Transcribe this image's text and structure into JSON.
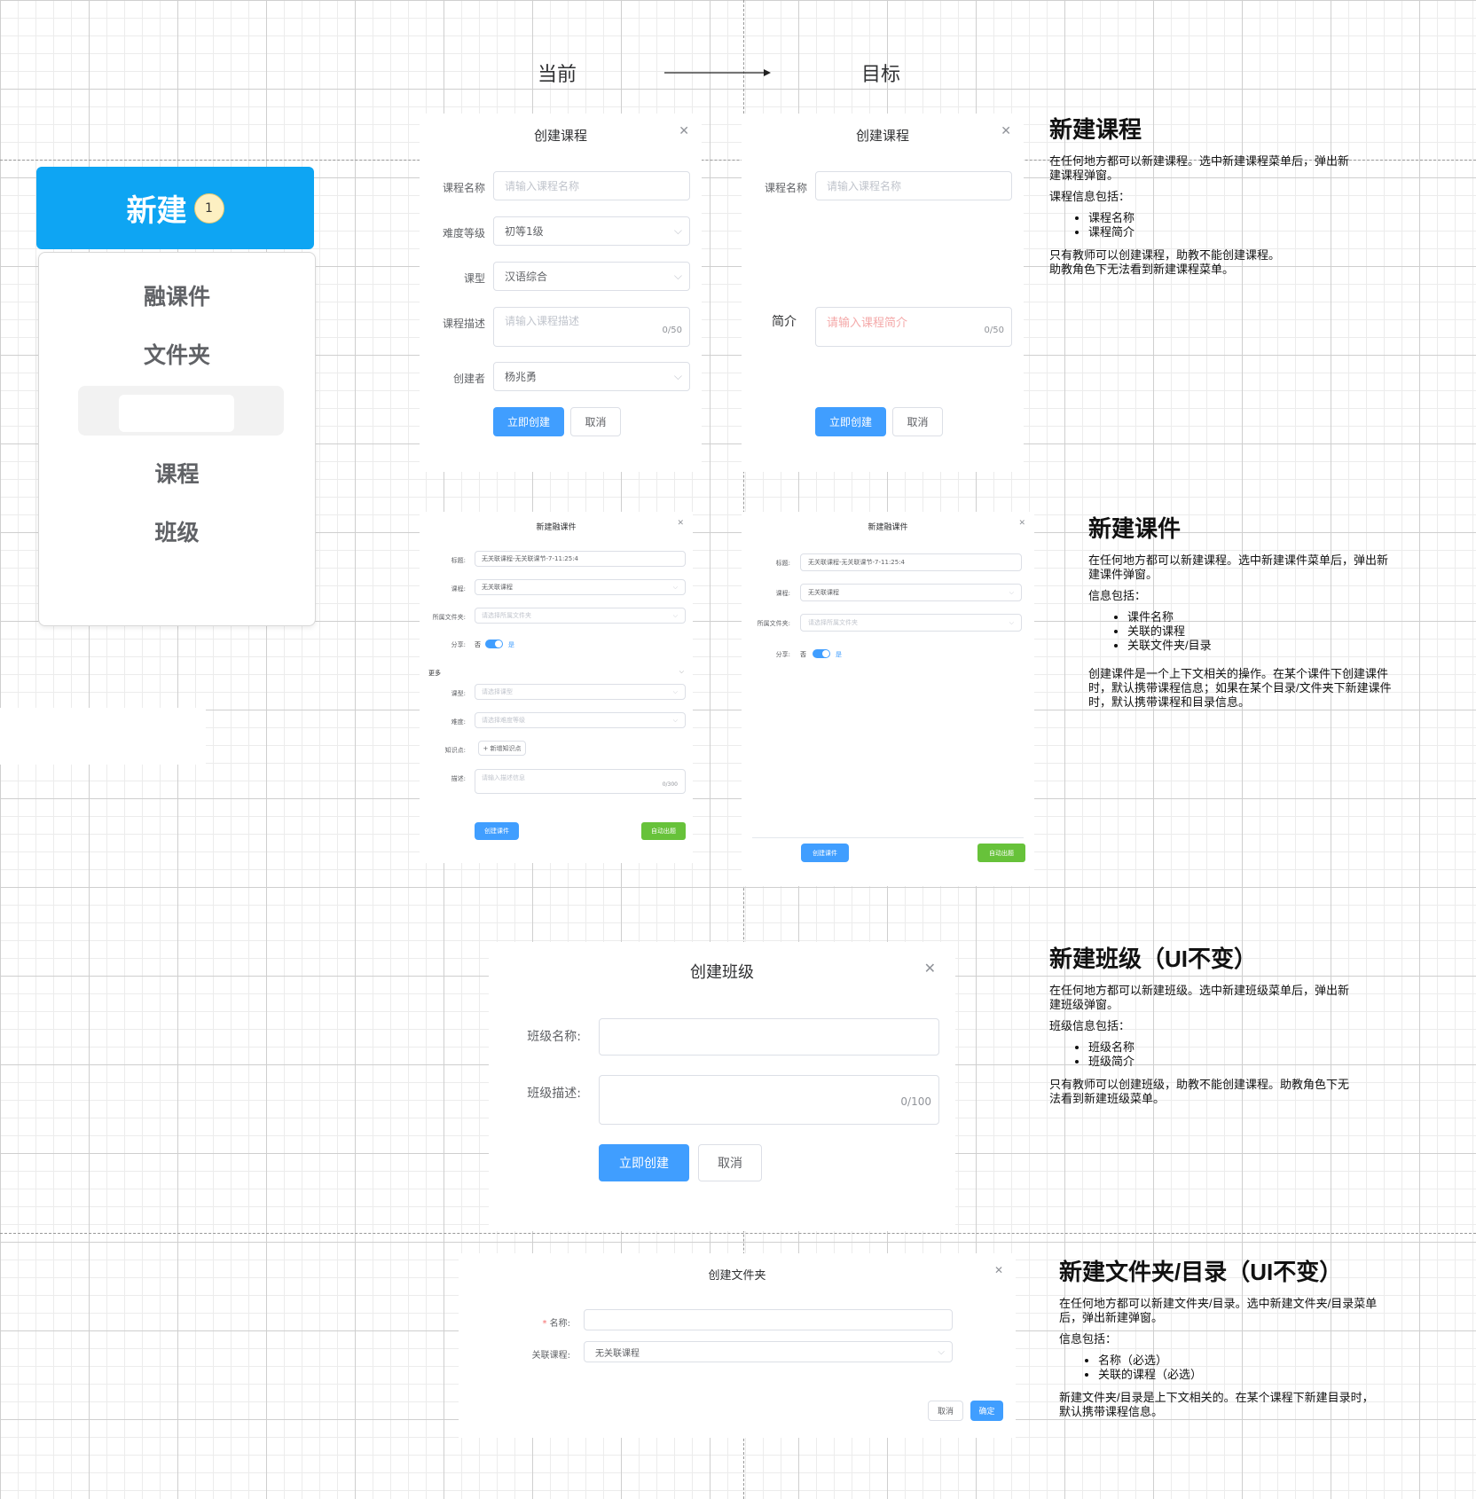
{
  "header": {
    "current_label": "当前",
    "target_label": "目标"
  },
  "menu": {
    "new_label": "新建",
    "badge": "1",
    "items": [
      "融课件",
      "文件夹",
      "课程",
      "班级"
    ]
  },
  "course_current": {
    "title": "创建课程",
    "name_label": "课程名称",
    "name_placeholder": "请输入课程名称",
    "level_label": "难度等级",
    "level_value": "初等1级",
    "type_label": "课型",
    "type_value": "汉语综合",
    "desc_label": "课程描述",
    "desc_placeholder": "请输入课程描述",
    "desc_count": "0/50",
    "creator_label": "创建者",
    "creator_value": "杨兆勇",
    "create_button": "立即创建",
    "cancel_button": "取消"
  },
  "course_target": {
    "title": "创建课程",
    "name_label": "课程名称",
    "name_placeholder": "请输入课程名称",
    "intro_label": "简介",
    "intro_placeholder": "请输入课程简介",
    "intro_count": "0/50",
    "create_button": "立即创建",
    "cancel_button": "取消"
  },
  "courseware_current": {
    "title": "新建融课件",
    "title_label": "标题:",
    "title_value": "无关联课程-无关联课节-7-11:25:4",
    "course_label": "课程:",
    "course_value": "无关联课程",
    "folder_label": "所属文件夹:",
    "folder_placeholder": "请选择所属文件夹",
    "share_label": "分享:",
    "share_no": "否",
    "share_yes": "是",
    "more_label": "更多",
    "ctype_label": "课型:",
    "ctype_placeholder": "请选择课型",
    "difficulty_label": "难度:",
    "difficulty_placeholder": "请选择难度等级",
    "knowledge_label": "知识点:",
    "knowledge_button": "+ 新增知识点",
    "desc_label": "描述:",
    "desc_placeholder": "请输入描述信息",
    "desc_count": "0/300",
    "create_button": "创建课件",
    "auto_button": "自动出题"
  },
  "courseware_target": {
    "title": "新建融课件",
    "title_label": "标题:",
    "title_value": "无关联课程-无关联课节-7-11:25:4",
    "course_label": "课程:",
    "course_value": "无关联课程",
    "folder_label": "所属文件夹:",
    "folder_placeholder": "请选择所属文件夹",
    "share_label": "分享:",
    "share_no": "否",
    "share_yes": "是",
    "create_button": "创建课件",
    "auto_button": "自动出题"
  },
  "class_dialog": {
    "title": "创建班级",
    "name_label": "班级名称:",
    "desc_label": "班级描述:",
    "desc_count": "0/100",
    "create_button": "立即创建",
    "cancel_button": "取消"
  },
  "folder_dialog": {
    "title": "创建文件夹",
    "required_mark": "*",
    "name_label": "名称:",
    "course_label": "关联课程:",
    "course_value": "无关联课程",
    "cancel_button": "取消",
    "ok_button": "确定"
  },
  "notes": {
    "course": {
      "heading": "新建课程",
      "p1": "在任何地方都可以新建课程。选中新建课程菜单后，弹出新建课程弹窗。",
      "p2": "课程信息包括：",
      "items": [
        "课程名称",
        "课程简介"
      ],
      "p3": "只有教师可以创建课程，助教不能创建课程。",
      "p4": "助教角色下无法看到新建课程菜单。"
    },
    "courseware": {
      "heading": "新建课件",
      "p1": "在任何地方都可以新建课程。选中新建课件菜单后，弹出新建课件弹窗。",
      "p2": "信息包括：",
      "items": [
        "课件名称",
        "关联的课程",
        "关联文件夹/目录"
      ],
      "p3": "创建课件是一个上下文相关的操作。在某个课件下创建课件时，默认携带课程信息；如果在某个目录/文件夹下新建课件时，默认携带课程和目录信息。"
    },
    "class": {
      "heading": "新建班级（UI不变）",
      "p1": "在任何地方都可以新建班级。选中新建班级菜单后，弹出新建班级弹窗。",
      "p2": "班级信息包括：",
      "items": [
        "班级名称",
        "班级简介"
      ],
      "p3": "只有教师可以创建班级，助教不能创建课程。助教角色下无法看到新建班级菜单。"
    },
    "folder": {
      "heading": "新建文件夹/目录（UI不变）",
      "p1": "在任何地方都可以新建文件夹/目录。选中新建文件夹/目录菜单后，弹出新建弹窗。",
      "p2": "信息包括：",
      "items": [
        "名称（必选）",
        "关联的课程（必选）"
      ],
      "p3": "新建文件夹/目录是上下文相关的。在某个课程下新建目录时，默认携带课程信息。"
    }
  }
}
